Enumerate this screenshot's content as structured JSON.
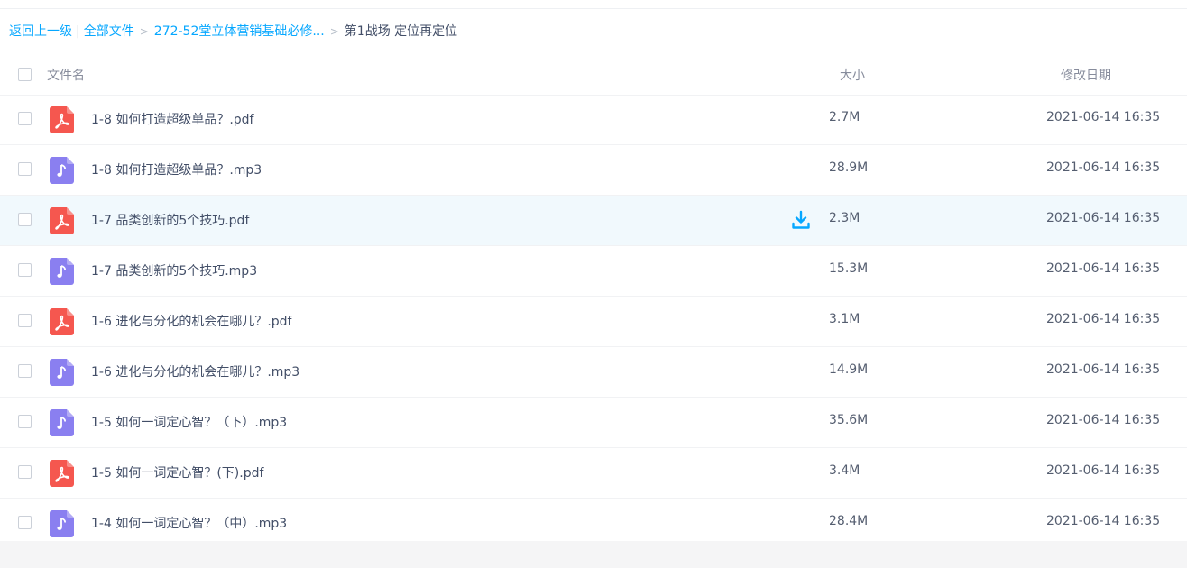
{
  "breadcrumb": {
    "back": "返回上一级",
    "all_files": "全部文件",
    "parent": "272-52堂立体营销基础必修...",
    "sep": ">",
    "current": "第1战场 定位再定位"
  },
  "columns": {
    "name": "文件名",
    "size": "大小",
    "date": "修改日期"
  },
  "colors": {
    "pdf": "#f5574f",
    "audio": "#8a7ff0",
    "link": "#06a7ff",
    "hover_row": "#f1f9fd"
  },
  "files": [
    {
      "name": "1-8 如何打造超级单品？.pdf",
      "size": "2.7M",
      "date": "2021-06-14 16:35",
      "type": "pdf-icon"
    },
    {
      "name": "1-8 如何打造超级单品？.mp3",
      "size": "28.9M",
      "date": "2021-06-14 16:35",
      "type": "audio-icon"
    },
    {
      "name": "1-7 品类创新的5个技巧.pdf",
      "size": "2.3M",
      "date": "2021-06-14 16:35",
      "type": "pdf-icon",
      "hover": true
    },
    {
      "name": "1-7 品类创新的5个技巧.mp3",
      "size": "15.3M",
      "date": "2021-06-14 16:35",
      "type": "audio-icon"
    },
    {
      "name": "1-6 进化与分化的机会在哪儿？.pdf",
      "size": "3.1M",
      "date": "2021-06-14 16:35",
      "type": "pdf-icon"
    },
    {
      "name": "1-6 进化与分化的机会在哪儿？.mp3",
      "size": "14.9M",
      "date": "2021-06-14 16:35",
      "type": "audio-icon"
    },
    {
      "name": "1-5 如何一词定心智？（下）.mp3",
      "size": "35.6M",
      "date": "2021-06-14 16:35",
      "type": "audio-icon"
    },
    {
      "name": "1-5 如何一词定心智？(下).pdf",
      "size": "3.4M",
      "date": "2021-06-14 16:35",
      "type": "pdf-icon"
    },
    {
      "name": "1-4 如何一词定心智？（中）.mp3",
      "size": "28.4M",
      "date": "2021-06-14 16:35",
      "type": "audio-icon"
    }
  ]
}
